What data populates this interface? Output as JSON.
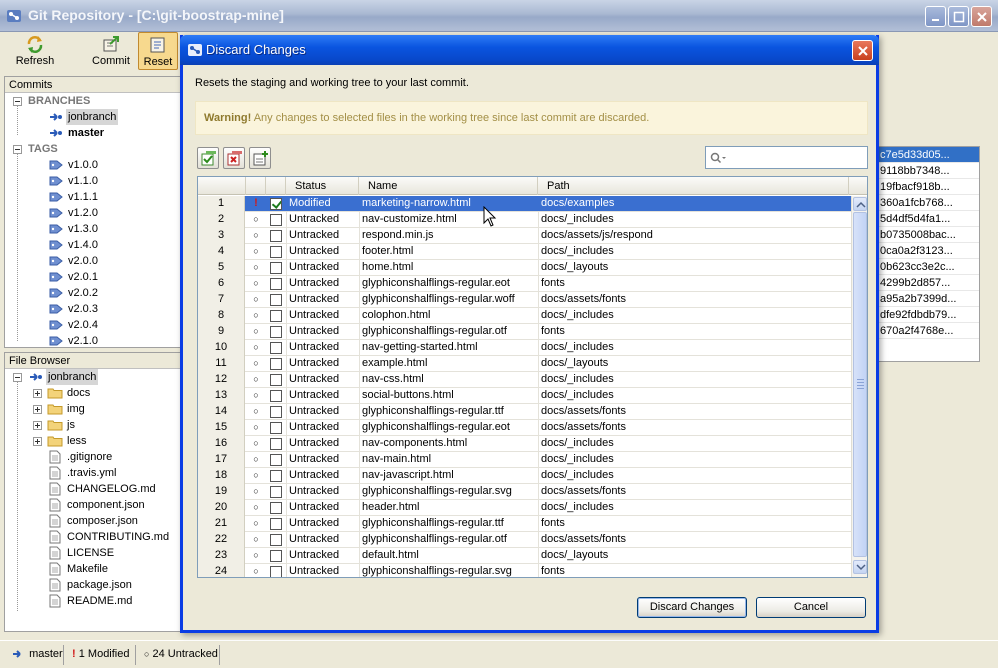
{
  "window": {
    "title": "Git Repository - [C:\\git-boostrap-mine]"
  },
  "toolbar": {
    "refresh_label": "Refresh",
    "commit_label": "Commit",
    "reset_label": "Reset"
  },
  "commits_panel": {
    "title": "Commits",
    "branches_label": "BRANCHES",
    "branches": [
      "jonbranch",
      "master"
    ],
    "tags_label": "TAGS",
    "tags": [
      "v1.0.0",
      "v1.1.0",
      "v1.1.1",
      "v1.2.0",
      "v1.3.0",
      "v1.4.0",
      "v2.0.0",
      "v2.0.1",
      "v2.0.2",
      "v2.0.3",
      "v2.0.4",
      "v2.1.0"
    ]
  },
  "file_browser": {
    "title": "File Browser",
    "root": "jonbranch",
    "folders": [
      "docs",
      "img",
      "js",
      "less"
    ],
    "files": [
      ".gitignore",
      ".travis.yml",
      "CHANGELOG.md",
      "component.json",
      "composer.json",
      "CONTRIBUTING.md",
      "LICENSE",
      "Makefile",
      "package.json",
      "README.md"
    ]
  },
  "commit_hashes": [
    "c7e5d33d05...",
    "9118bb7348...",
    "19fbacf918b...",
    "360a1fcb768...",
    "5d4df5d4fa1...",
    "b0735008bac...",
    "0ca0a2f3123...",
    "0b623cc3e2c...",
    "4299b2d857...",
    "a95a2b7399d...",
    "dfe92fdbdb79...",
    "670a2f4768e..."
  ],
  "status_bar": {
    "branch": "master",
    "modified": "1 Modified",
    "untracked": "24 Untracked"
  },
  "dialog": {
    "title": "Discard Changes",
    "description": "Resets the staging and working tree to your last commit.",
    "warning_label": "Warning!",
    "warning_text": "Any changes to selected files in the working tree since last commit are discarded.",
    "columns": {
      "status": "Status",
      "name": "Name",
      "path": "Path"
    },
    "discard_button": "Discard Changes",
    "cancel_button": "Cancel"
  },
  "files": [
    {
      "num": "1",
      "status": "Modified",
      "name": "marketing-narrow.html",
      "path": "docs/examples",
      "checked": true
    },
    {
      "num": "2",
      "status": "Untracked",
      "name": "nav-customize.html",
      "path": "docs/_includes"
    },
    {
      "num": "3",
      "status": "Untracked",
      "name": "respond.min.js",
      "path": "docs/assets/js/respond"
    },
    {
      "num": "4",
      "status": "Untracked",
      "name": "footer.html",
      "path": "docs/_includes"
    },
    {
      "num": "5",
      "status": "Untracked",
      "name": "home.html",
      "path": "docs/_layouts"
    },
    {
      "num": "6",
      "status": "Untracked",
      "name": "glyphiconshalflings-regular.eot",
      "path": "fonts"
    },
    {
      "num": "7",
      "status": "Untracked",
      "name": "glyphiconshalflings-regular.woff",
      "path": "docs/assets/fonts"
    },
    {
      "num": "8",
      "status": "Untracked",
      "name": "colophon.html",
      "path": "docs/_includes"
    },
    {
      "num": "9",
      "status": "Untracked",
      "name": "glyphiconshalflings-regular.otf",
      "path": "fonts"
    },
    {
      "num": "10",
      "status": "Untracked",
      "name": "nav-getting-started.html",
      "path": "docs/_includes"
    },
    {
      "num": "11",
      "status": "Untracked",
      "name": "example.html",
      "path": "docs/_layouts"
    },
    {
      "num": "12",
      "status": "Untracked",
      "name": "nav-css.html",
      "path": "docs/_includes"
    },
    {
      "num": "13",
      "status": "Untracked",
      "name": "social-buttons.html",
      "path": "docs/_includes"
    },
    {
      "num": "14",
      "status": "Untracked",
      "name": "glyphiconshalflings-regular.ttf",
      "path": "docs/assets/fonts"
    },
    {
      "num": "15",
      "status": "Untracked",
      "name": "glyphiconshalflings-regular.eot",
      "path": "docs/assets/fonts"
    },
    {
      "num": "16",
      "status": "Untracked",
      "name": "nav-components.html",
      "path": "docs/_includes"
    },
    {
      "num": "17",
      "status": "Untracked",
      "name": "nav-main.html",
      "path": "docs/_includes"
    },
    {
      "num": "18",
      "status": "Untracked",
      "name": "nav-javascript.html",
      "path": "docs/_includes"
    },
    {
      "num": "19",
      "status": "Untracked",
      "name": "glyphiconshalflings-regular.svg",
      "path": "docs/assets/fonts"
    },
    {
      "num": "20",
      "status": "Untracked",
      "name": "header.html",
      "path": "docs/_includes"
    },
    {
      "num": "21",
      "status": "Untracked",
      "name": "glyphiconshalflings-regular.ttf",
      "path": "fonts"
    },
    {
      "num": "22",
      "status": "Untracked",
      "name": "glyphiconshalflings-regular.otf",
      "path": "docs/assets/fonts"
    },
    {
      "num": "23",
      "status": "Untracked",
      "name": "default.html",
      "path": "docs/_layouts"
    },
    {
      "num": "24",
      "status": "Untracked",
      "name": "glyphiconshalflings-regular.svg",
      "path": "fonts"
    }
  ],
  "colors": {
    "dialog_title": "#0a55e0",
    "selection": "#3a6fd0",
    "warning_bg": "#faf4dc",
    "modified_marker": "#d11b1b"
  }
}
